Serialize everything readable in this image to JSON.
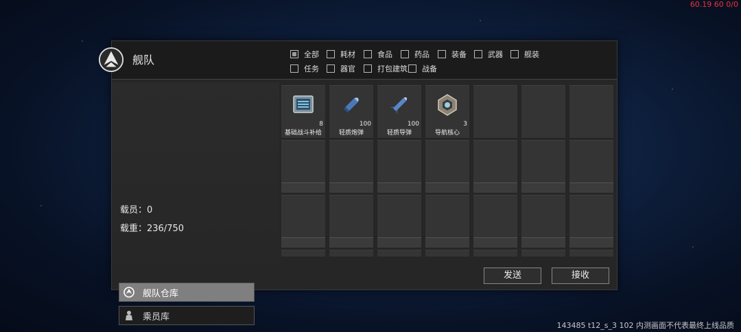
{
  "overlay": {
    "fps_text": "60.19 60 0/0",
    "build_text": "143485 t12_s_3 102  内测画面不代表最终上线品质"
  },
  "panel": {
    "title": "舰队"
  },
  "filters": [
    {
      "label": "全部",
      "checked": true
    },
    {
      "label": "耗材",
      "checked": false
    },
    {
      "label": "食品",
      "checked": false
    },
    {
      "label": "药品",
      "checked": false
    },
    {
      "label": "装备",
      "checked": false
    },
    {
      "label": "武器",
      "checked": false
    },
    {
      "label": "舰装",
      "checked": false
    },
    {
      "label": "任务",
      "checked": false
    },
    {
      "label": "器官",
      "checked": false
    },
    {
      "label": "打包建筑",
      "checked": false
    },
    {
      "label": "战备",
      "checked": false
    }
  ],
  "stats": {
    "crew": "载员：0",
    "load": "载重：236/750"
  },
  "nav": {
    "fleet_storage": "舰队仓库",
    "crew_storage": "乘员库"
  },
  "items": [
    {
      "name": "基础战斗补给",
      "qty": "8",
      "icon": "supply-crate-icon"
    },
    {
      "name": "轻质炮弹",
      "qty": "100",
      "icon": "cannon-shell-icon"
    },
    {
      "name": "轻质导弹",
      "qty": "100",
      "icon": "missile-icon"
    },
    {
      "name": "导航核心",
      "qty": "3",
      "icon": "nav-core-icon"
    }
  ],
  "actions": {
    "send": "发送",
    "receive": "接收"
  }
}
